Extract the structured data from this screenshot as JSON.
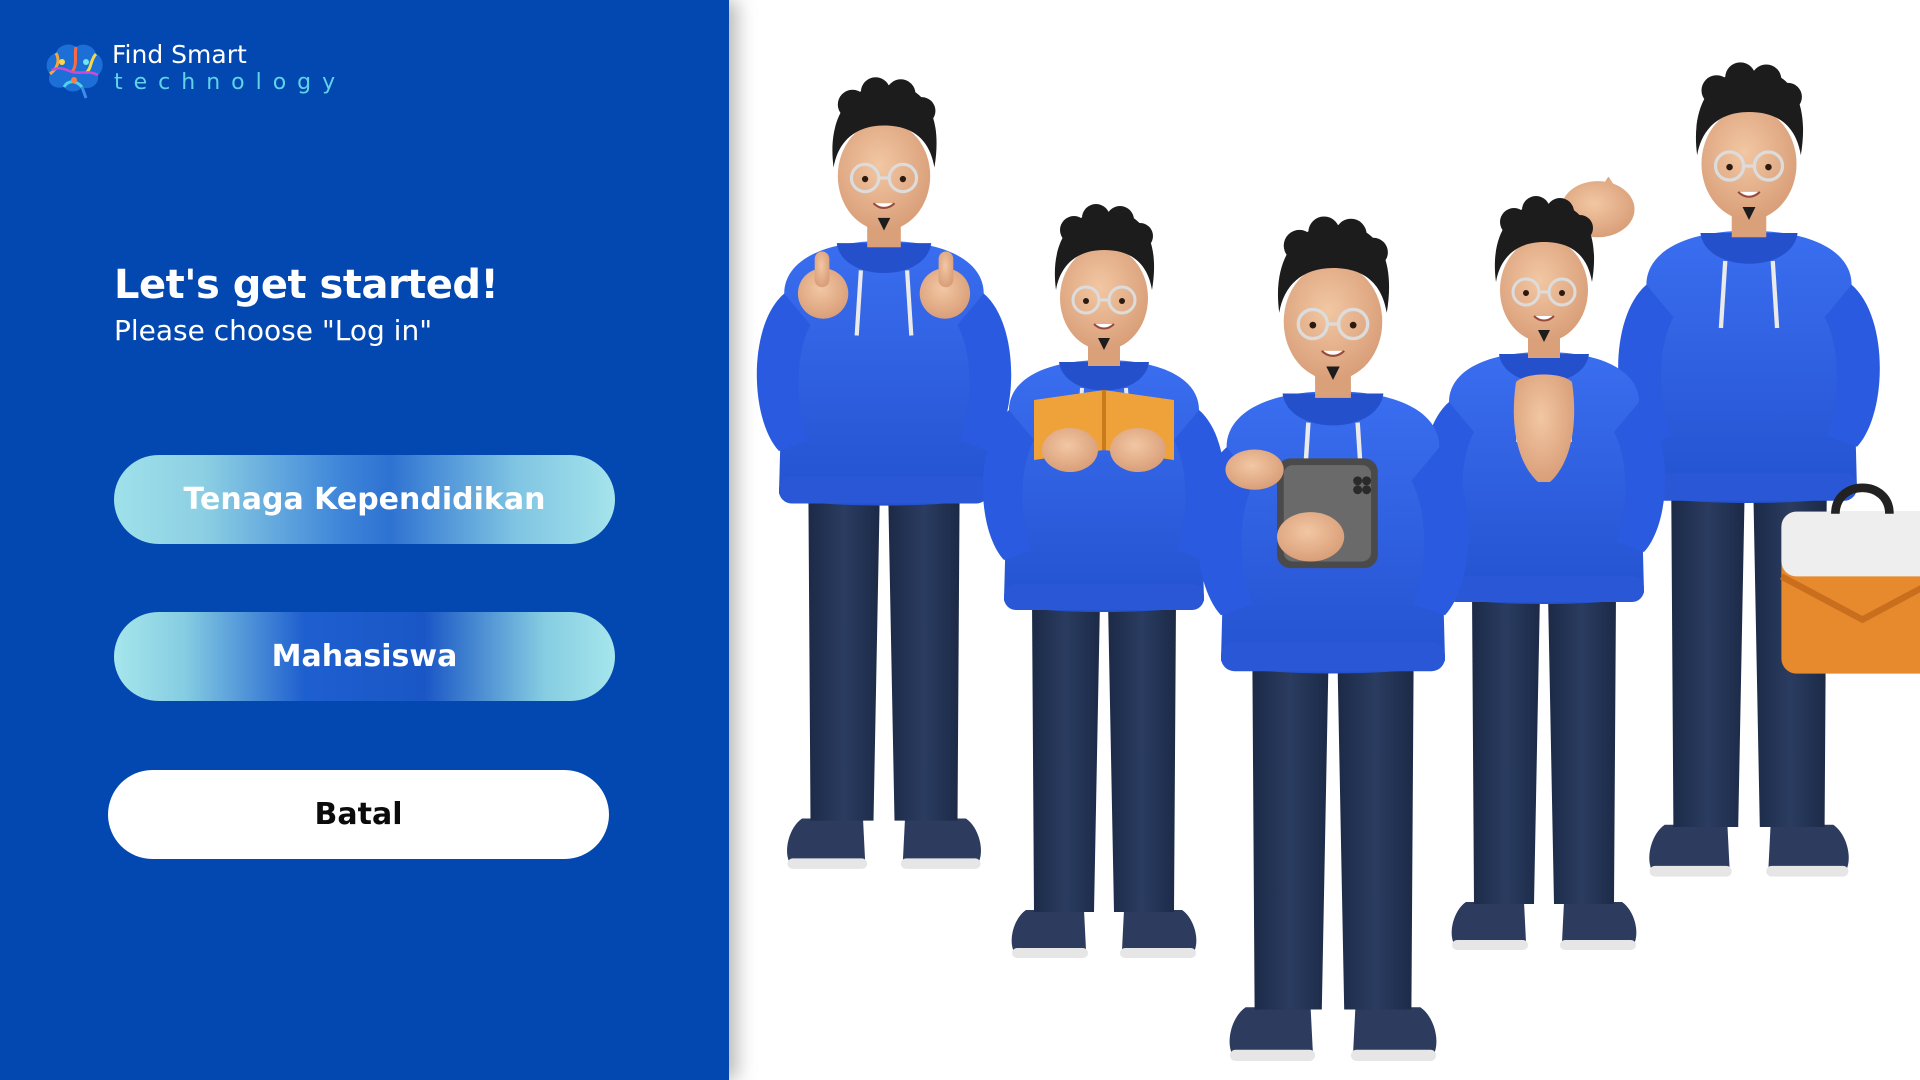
{
  "brand": {
    "name_line1": "Find Smart",
    "name_line2": "technology",
    "logo_icon": "brain-icon"
  },
  "intro": {
    "heading": "Let's get started!",
    "subheading": "Please choose \"Log in\""
  },
  "buttons": {
    "staff_label": "Tenaga Kependidikan",
    "student_label": "Mahasiswa",
    "cancel_label": "Batal"
  },
  "illustration": {
    "description_icon": "students-group-illustration"
  },
  "colors": {
    "panel_bg": "#0347b0",
    "accent_cyan": "#5fd3e8",
    "hoodie_blue": "#2f5fe0",
    "pants_navy": "#1f2f4f",
    "background": "#ffffff"
  }
}
